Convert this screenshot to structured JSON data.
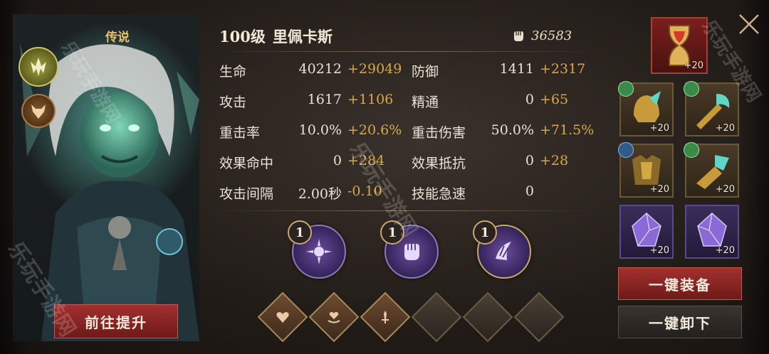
{
  "hero": {
    "rarity": "传说",
    "upgrade_button": "前往提升"
  },
  "stats": {
    "level_label": "100级",
    "hero_name": "里佩卡斯",
    "power": "36583",
    "rows": [
      {
        "label": "生命",
        "base": "40212",
        "bonus": "+29049"
      },
      {
        "label": "防御",
        "base": "1411",
        "bonus": "+2317"
      },
      {
        "label": "攻击",
        "base": "1617",
        "bonus": "+1106"
      },
      {
        "label": "精通",
        "base": "0",
        "bonus": "+65"
      },
      {
        "label": "重击率",
        "base": "10.0%",
        "bonus": "+20.6%"
      },
      {
        "label": "重击伤害",
        "base": "50.0%",
        "bonus": "+71.5%"
      },
      {
        "label": "效果命中",
        "base": "0",
        "bonus": "+284"
      },
      {
        "label": "效果抵抗",
        "base": "0",
        "bonus": "+28"
      },
      {
        "label": "攻击间隔",
        "base": "2.00秒",
        "bonus": "-0.10"
      },
      {
        "label": "技能急速",
        "base": "0",
        "bonus": ""
      }
    ]
  },
  "skills": [
    {
      "level": "1",
      "icon": "sun-icon"
    },
    {
      "level": "1",
      "icon": "fist-icon"
    },
    {
      "level": "1",
      "icon": "claw-icon"
    }
  ],
  "runes": [
    "heart-icon",
    "heart-hand-icon",
    "sword-icon",
    "empty",
    "empty",
    "empty"
  ],
  "equipment": {
    "artifact_level": "+20",
    "items": [
      {
        "level": "+20",
        "icon": "helmet-icon"
      },
      {
        "level": "+20",
        "icon": "weapon-icon"
      },
      {
        "level": "+20",
        "icon": "armor-icon"
      },
      {
        "level": "+20",
        "icon": "gauntlet-icon"
      },
      {
        "level": "+20",
        "icon": "crystal-icon"
      },
      {
        "level": "+20",
        "icon": "crystal-icon"
      }
    ],
    "equip_all": "一键装备",
    "unequip_all": "一键卸下"
  },
  "watermark": "乐玩手游网",
  "colors": {
    "bonus": "#d9a64a",
    "accent_red": "#a2302e",
    "rarity": "#e6c36a"
  }
}
